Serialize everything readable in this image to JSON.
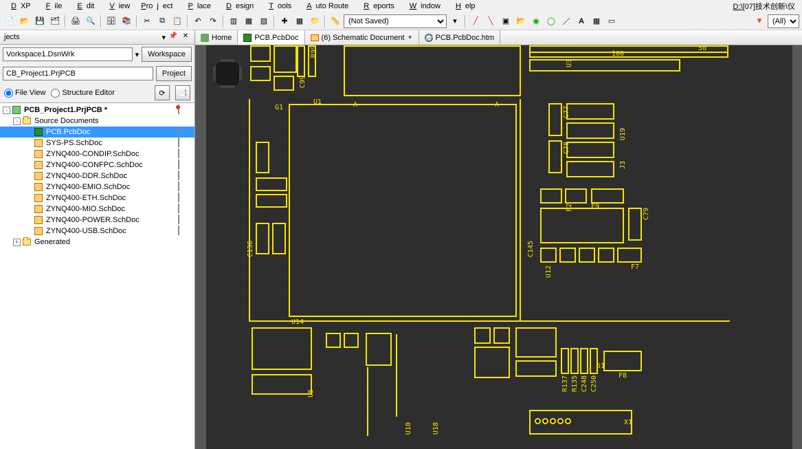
{
  "menus": [
    "DXP",
    "File",
    "Edit",
    "View",
    "Project",
    "Place",
    "Design",
    "Tools",
    "Auto Route",
    "Reports",
    "Window",
    "Help"
  ],
  "right_path": "D:\\[07]技术创新\\仪",
  "toolbar": {
    "save_dropdown": "(Not Saved)",
    "filter_dropdown": "(All)"
  },
  "panel": {
    "title": "jects",
    "workspace_value": "Vorkspace1.DsnWrk",
    "workspace_btn": "Workspace",
    "project_value": "CB_Project1.PrjPCB",
    "project_btn": "Project",
    "radio_file": "File View",
    "radio_structure": "Structure Editor"
  },
  "tree": [
    {
      "depth": 0,
      "exp": "-",
      "icon": "proj",
      "label": "PCB_Project1.PrjPCB *",
      "ri": "red",
      "bold": true
    },
    {
      "depth": 1,
      "exp": "-",
      "icon": "folder",
      "label": "Source Documents",
      "ri": ""
    },
    {
      "depth": 2,
      "exp": "",
      "icon": "pcb",
      "label": "PCB.PcbDoc",
      "ri": "doc",
      "sel": true
    },
    {
      "depth": 2,
      "exp": "",
      "icon": "sch",
      "label": "SYS-PS.SchDoc",
      "ri": "doc"
    },
    {
      "depth": 2,
      "exp": "",
      "icon": "sch",
      "label": "ZYNQ400-CONDIP.SchDoc",
      "ri": "doc"
    },
    {
      "depth": 2,
      "exp": "",
      "icon": "sch",
      "label": "ZYNQ400-CONFPC.SchDoc",
      "ri": "doc"
    },
    {
      "depth": 2,
      "exp": "",
      "icon": "sch",
      "label": "ZYNQ400-DDR.SchDoc",
      "ri": "doc"
    },
    {
      "depth": 2,
      "exp": "",
      "icon": "sch",
      "label": "ZYNQ400-EMIO.SchDoc",
      "ri": "doc"
    },
    {
      "depth": 2,
      "exp": "",
      "icon": "sch",
      "label": "ZYNQ400-ETH.SchDoc",
      "ri": "doc"
    },
    {
      "depth": 2,
      "exp": "",
      "icon": "sch",
      "label": "ZYNQ400-MIO.SchDoc",
      "ri": "doc"
    },
    {
      "depth": 2,
      "exp": "",
      "icon": "sch",
      "label": "ZYNQ400-POWER.SchDoc",
      "ri": "doc"
    },
    {
      "depth": 2,
      "exp": "",
      "icon": "sch",
      "label": "ZYNQ400-USB.SchDoc",
      "ri": "doc"
    },
    {
      "depth": 1,
      "exp": "+",
      "icon": "folder",
      "label": "Generated",
      "ri": ""
    }
  ],
  "doc_tabs": [
    {
      "icon": "home",
      "label": "Home",
      "dd": false
    },
    {
      "icon": "pcb",
      "label": "PCB.PcbDoc",
      "dd": false,
      "active": true
    },
    {
      "icon": "foldy",
      "label": "(6) Schematic Document",
      "dd": true
    },
    {
      "icon": "ie",
      "label": "PCB.PcbDoc.htm",
      "dd": false
    }
  ],
  "silk_labels": {
    "l50": "50",
    "l100": "100",
    "l51": "51",
    "G1": "G1",
    "U1": "U1",
    "A1": "A",
    "A2": "A",
    "C99": "C99",
    "R99": "R99",
    "C77": "C77",
    "C78": "C78",
    "U19": "U19",
    "J3": "J3",
    "F2": "F2",
    "F9": "F9",
    "C79": "C79",
    "C145": "C145",
    "U12": "U12",
    "F7": "F7",
    "C136": "C136",
    "U14": "U14",
    "U3": "U3",
    "U5": "U5",
    "U10": "U10",
    "U18": "U18",
    "R137": "R137",
    "R135": "R135",
    "C248": "C248",
    "C250": "C250",
    "F8": "F8",
    "X1": "X1"
  }
}
